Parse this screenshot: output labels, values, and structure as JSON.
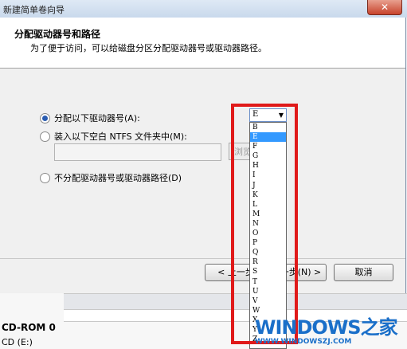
{
  "window": {
    "title": "新建简单卷向导",
    "close_label": "✕"
  },
  "header": {
    "title": "分配驱动器号和路径",
    "description": "为了便于访问，可以给磁盘分区分配驱动器号或驱动器路径。"
  },
  "options": {
    "assign_letter_label": "分配以下驱动器号(A):",
    "mount_folder_label": "装入以下空白 NTFS 文件夹中(M):",
    "no_assign_label": "不分配驱动器号或驱动器路径(D)",
    "browse_label": "浏览"
  },
  "drive_select": {
    "selected_value": "E",
    "options": [
      "B",
      "E",
      "F",
      "G",
      "H",
      "I",
      "J",
      "K",
      "L",
      "M",
      "N",
      "O",
      "P",
      "Q",
      "R",
      "S",
      "T",
      "U",
      "V",
      "W",
      "X",
      "Y",
      "Z"
    ]
  },
  "buttons": {
    "prev_label": "< 上一步",
    "next_label": "下一步(N) >",
    "cancel_label": "取消"
  },
  "background": {
    "cdrom_label": "CD-ROM 0",
    "cdrom_sub": "CD (E:)"
  },
  "watermark": {
    "logo_text": "WINDOWS之家",
    "url_text": "WWW.WINDOWSZJ.COM"
  },
  "colors": {
    "highlight": "#e01a1a",
    "selection": "#3399ff",
    "accent": "#1a6fc9"
  }
}
